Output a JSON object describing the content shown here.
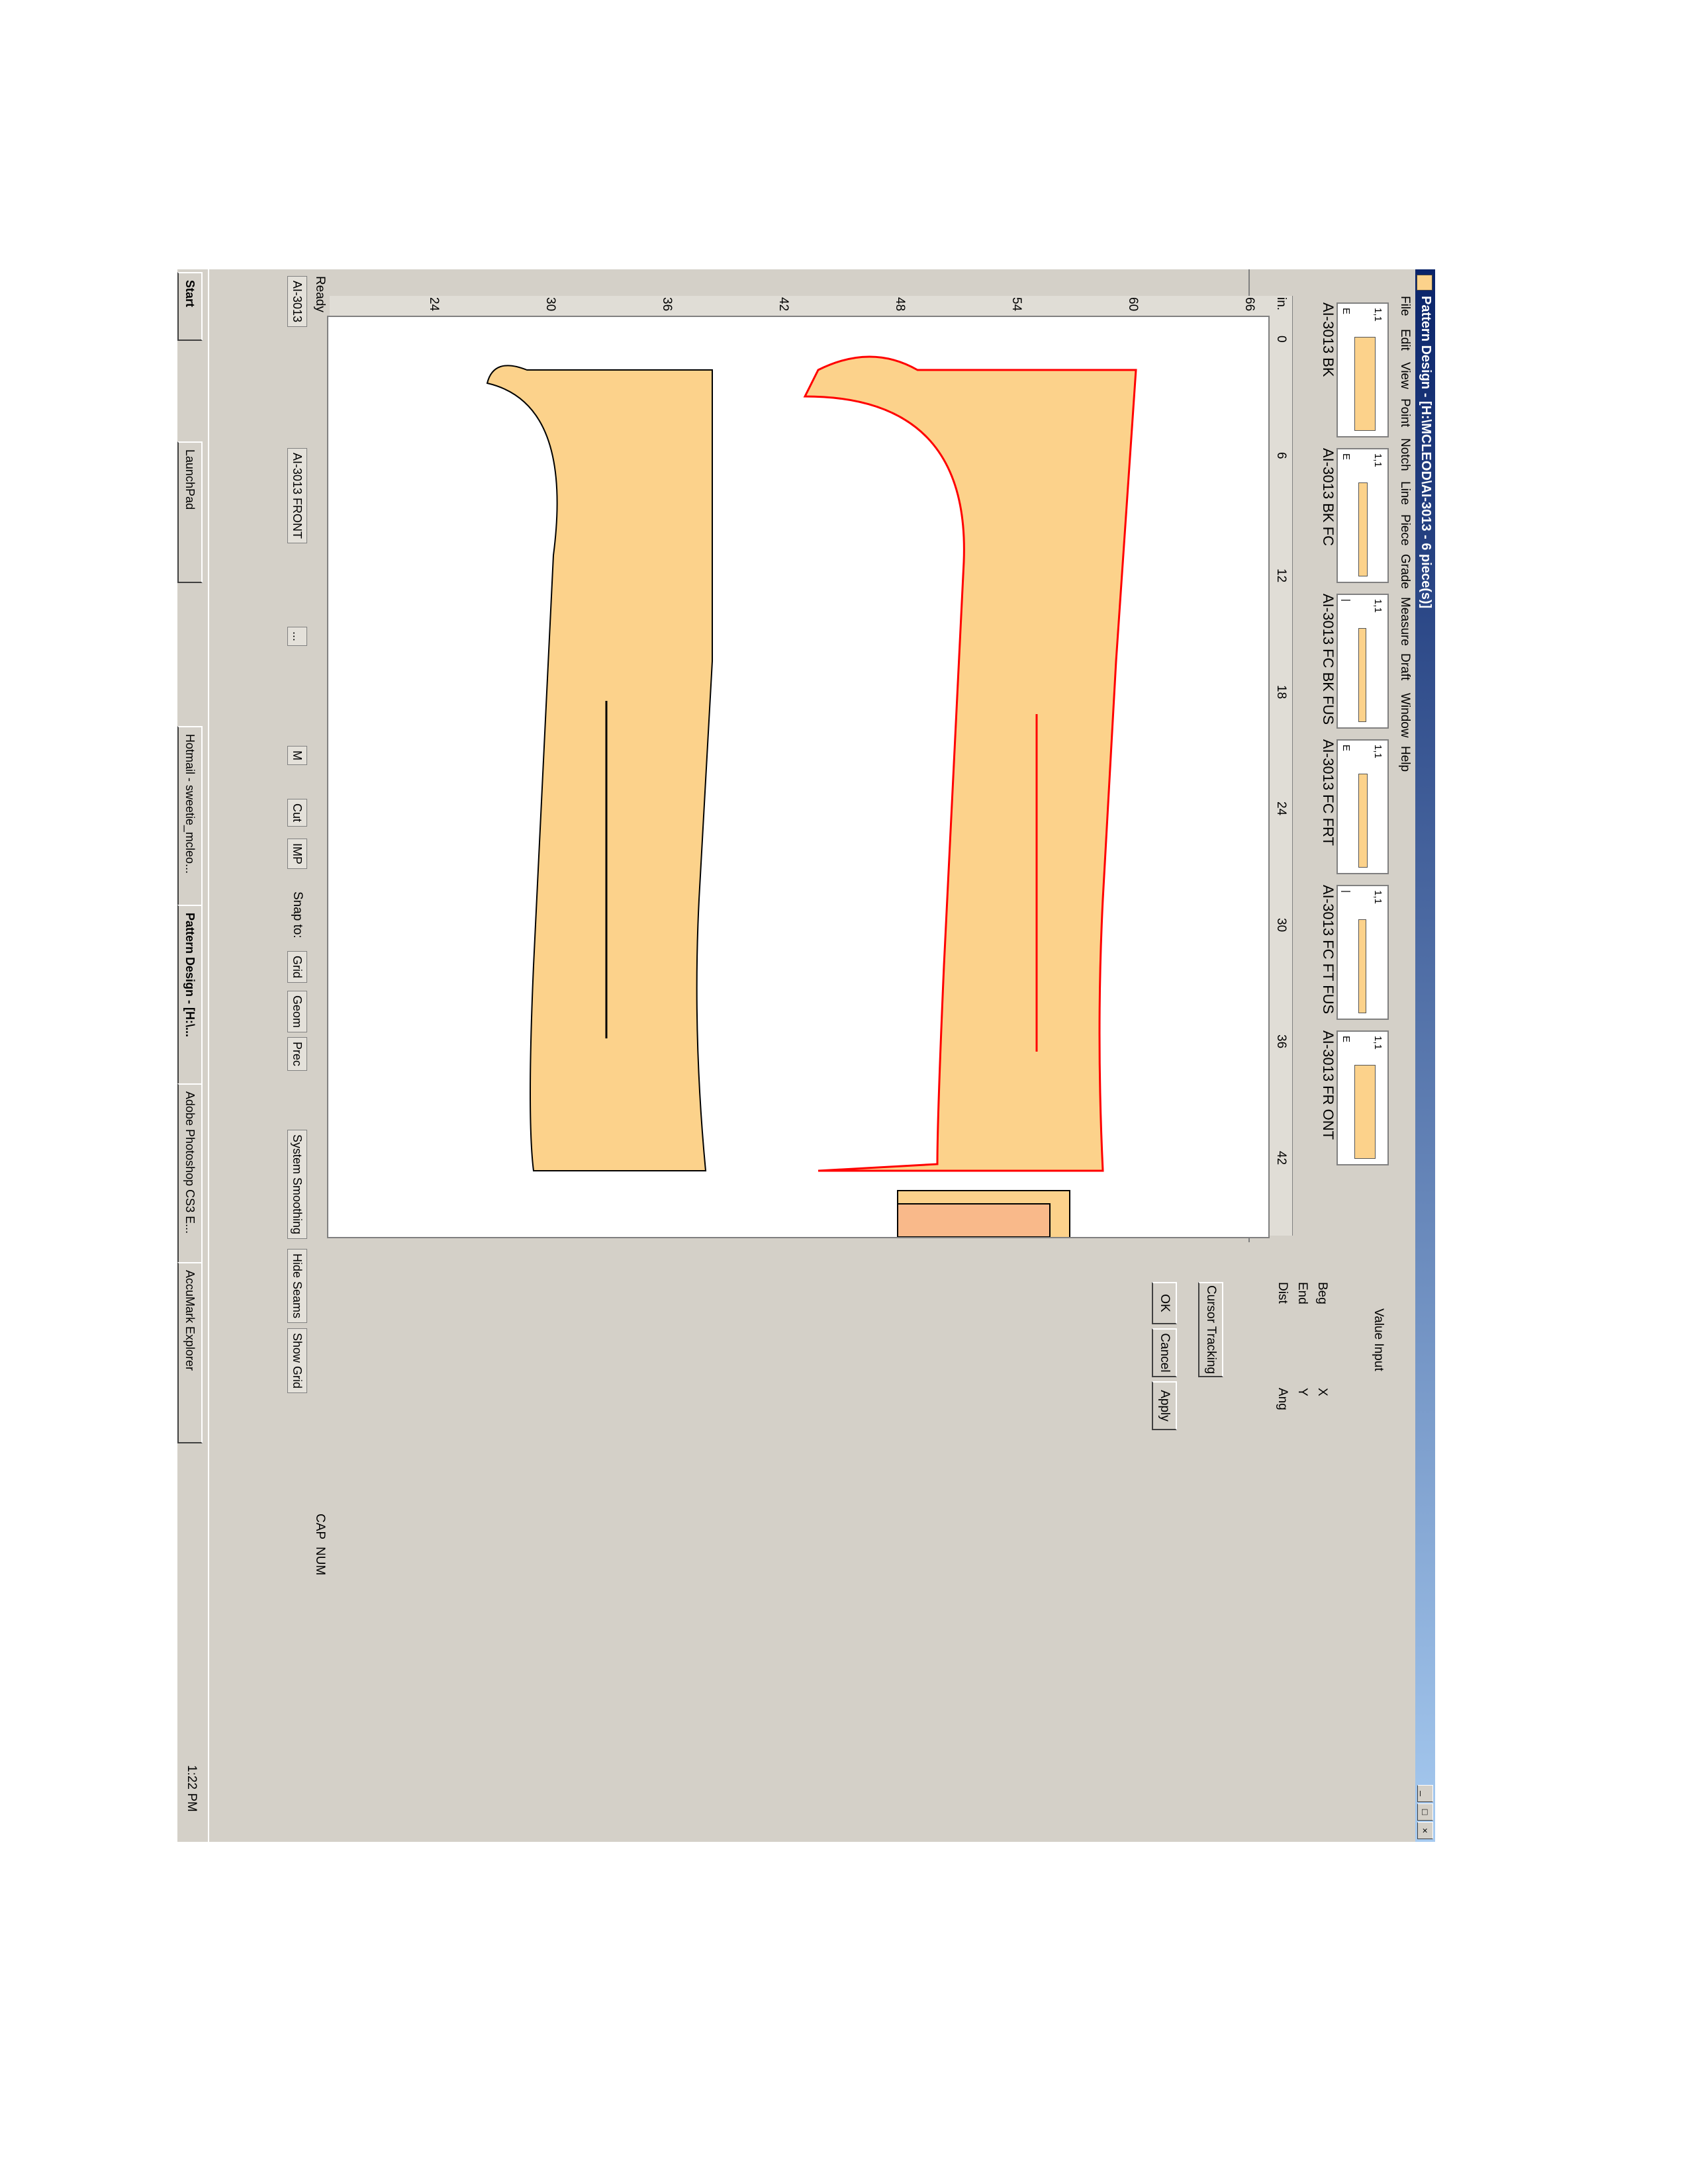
{
  "window": {
    "title": "Pattern Design - [H:\\MCLEOD\\AI-3013 - 6 piece(s)]",
    "controls": [
      "_",
      "□",
      "×"
    ]
  },
  "menu": [
    "File",
    "Edit",
    "View",
    "Point",
    "Notch",
    "Line",
    "Piece",
    "Grade",
    "Measure",
    "Draft",
    "Window",
    "Help"
  ],
  "pieces": [
    {
      "count": "1,1",
      "edge": "E",
      "label": "AI-3013 BK"
    },
    {
      "count": "1,1",
      "edge": "E",
      "label": "AI-3013 BK FC"
    },
    {
      "count": "1,1",
      "edge": "|",
      "label": "AI-3013 FC BK FUS"
    },
    {
      "count": "1,1",
      "edge": "E",
      "label": "AI-3013 FC FRT"
    },
    {
      "count": "1,1",
      "edge": "|",
      "label": "AI-3013 FC FT FUS"
    },
    {
      "count": "1,1",
      "edge": "E",
      "label": "AI-3013 FR ONT"
    }
  ],
  "ruler": {
    "unit": "in.",
    "top_ticks": [
      "0",
      "6",
      "12",
      "18",
      "24",
      "30",
      "36",
      "42",
      "48",
      "54",
      "60"
    ],
    "left_ticks": [
      "66",
      "60",
      "54",
      "48",
      "42",
      "36",
      "30",
      "24"
    ]
  },
  "value_input": {
    "title": "Value Input",
    "beg": "Beg",
    "end": "End",
    "dist": "Dist",
    "x": "X",
    "y": "Y",
    "ang": "Ang",
    "cursor_tracking": "Cursor Tracking",
    "ok": "OK",
    "cancel": "Cancel",
    "apply": "Apply"
  },
  "status": {
    "ready": "Ready",
    "cap": "CAP",
    "num": "NUM"
  },
  "bottom": {
    "style": "AI-3013",
    "piece": "AI-3013 FRONT",
    "browse": "...",
    "size": "M",
    "cut": "Cut",
    "imp": "IMP",
    "snap_to": "Snap to:",
    "grid": "Grid",
    "geom": "Geom",
    "prec": "Prec",
    "system_smoothing": "System Smoothing",
    "hide_seams": "Hide Seams",
    "show_grid": "Show Grid"
  },
  "taskbar": {
    "start": "Start",
    "launchpad": "LaunchPad",
    "items": [
      "Hotmail - sweetie_mcleo...",
      "Pattern Design - [H:\\...",
      "Adobe Photoshop CS3 E...",
      "AccuMark Explorer"
    ],
    "clock": "1:22 PM"
  },
  "colors": {
    "piece_fill": "#fcd28b",
    "piece_fill_alt": "#f9b98a",
    "selected_outline": "#ff0000",
    "titlebar": "#0a246a"
  },
  "icons": [
    "delete-icon",
    "clear-icon",
    "table-icon",
    "arrange-icon",
    "zoom-1to1-icon",
    "zoom-fit-icon",
    "zoom-window-icon",
    "zoom-out-icon",
    "zoom-in-icon",
    "pan-icon",
    "print-icon",
    "undo-icon",
    "redo-icon",
    "layer-icon",
    "piece-icon",
    "grade-icon",
    "notes-icon",
    "folder-icon"
  ]
}
